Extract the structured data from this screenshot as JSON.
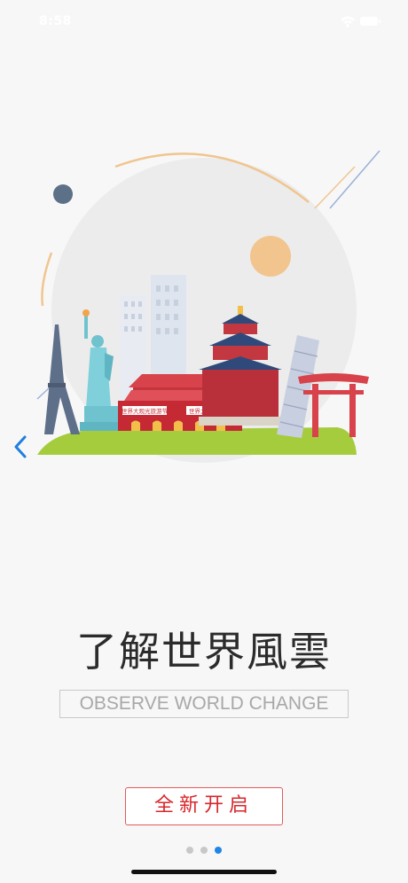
{
  "status_bar": {
    "time": "8:58",
    "icons": [
      "wifi-icon",
      "battery-icon"
    ]
  },
  "onboarding": {
    "title": "了解世界風雲",
    "subtitle": "OBSERVE WORLD CHANGE",
    "start_label": "全新开启",
    "page_indicator": {
      "total": 3,
      "current": 3
    },
    "illustration": {
      "banner_left": "世界大观光旅游节",
      "banner_right": "世界大观光旅游节"
    }
  },
  "colors": {
    "accent_red": "#d9262b",
    "active_dot": "#1f86e8",
    "back_arrow": "#1f7fe0"
  }
}
